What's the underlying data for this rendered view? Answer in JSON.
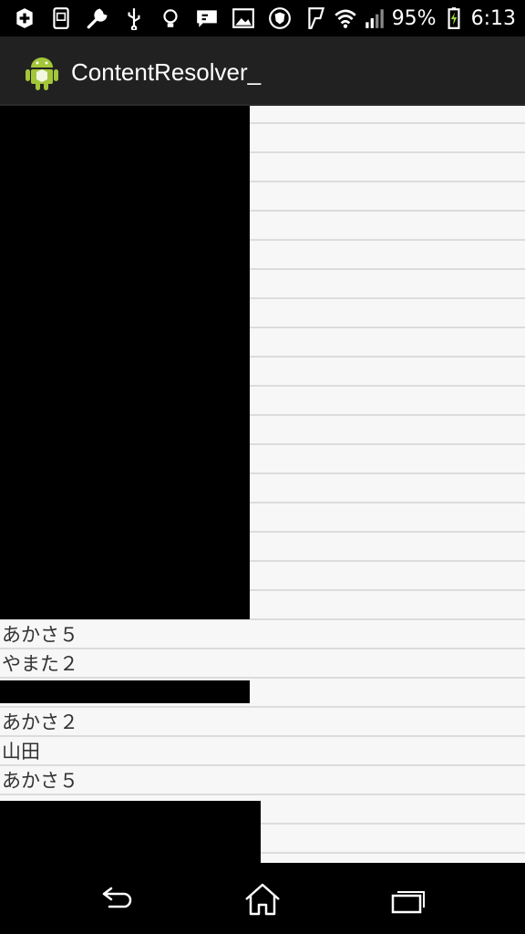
{
  "status_bar": {
    "battery_percent": "95%",
    "time": "6:13",
    "icons": [
      "add-box-icon",
      "sim-card-icon",
      "wrench-icon",
      "usb-icon",
      "bulb-icon",
      "message-icon",
      "image-icon",
      "shield-icon",
      "foursquare-icon",
      "wifi-icon",
      "signal-icon",
      "battery-charging-icon"
    ]
  },
  "action_bar": {
    "title": "ContentResolver_",
    "icon": "android-icon"
  },
  "list": {
    "items": [
      {
        "label": "あかさ５"
      },
      {
        "label": "やまた２"
      },
      {
        "label": "あかさ２"
      },
      {
        "label": "山田"
      },
      {
        "label": "あかさ５"
      }
    ]
  },
  "nav_bar": {
    "icons": [
      "back-icon",
      "home-icon",
      "recent-apps-icon"
    ]
  }
}
